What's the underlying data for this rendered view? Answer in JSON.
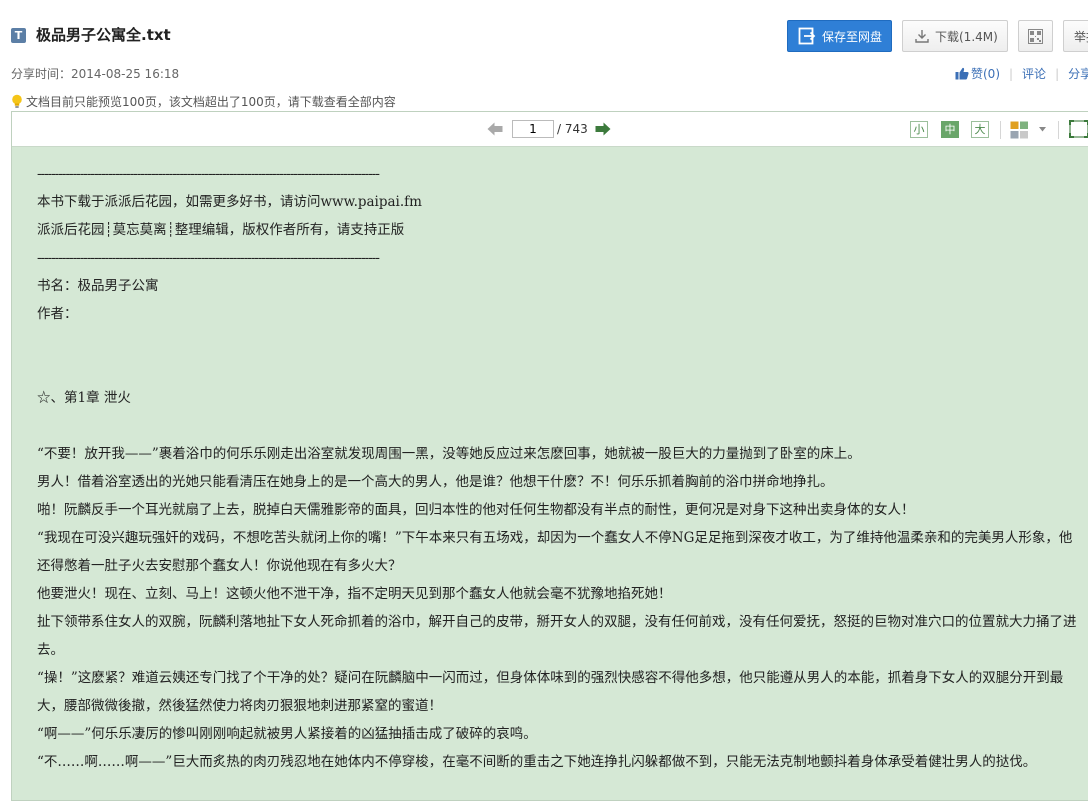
{
  "file": {
    "type_icon": "T",
    "title": "极品男子公寓全.txt"
  },
  "actions": {
    "save_label": "保存至网盘",
    "download_label": "下载(1.4M)",
    "report_label": "举报"
  },
  "meta": {
    "share_time": "分享时间：2014-08-25 16:18",
    "like_label": "赞(0)",
    "comment_label": "评论",
    "share_label": "分享"
  },
  "notice": "文档目前只能预览100页，该文档超出了100页，请下载查看全部内容",
  "viewer": {
    "current_page": "1",
    "total_pages": "/ 743",
    "size_small": "小",
    "size_medium": "中",
    "size_large": "大"
  },
  "colors": {
    "accent": "#2f7fd6",
    "reading_bg": "#d5e8d5",
    "link": "#3b6fb6"
  },
  "document": {
    "lines": [
      {
        "kind": "dash",
        "text": "------------------------------------------------------------------------------------------------"
      },
      {
        "kind": "text",
        "text": "本书下载于派派后花园，如需更多好书，请访问www.paipai.fm"
      },
      {
        "kind": "text",
        "text": "派派后花园┊莫忘莫离┊整理编辑，版权作者所有，请支持正版"
      },
      {
        "kind": "dash",
        "text": "------------------------------------------------------------------------------------------------"
      },
      {
        "kind": "text",
        "text": "书名：极品男子公寓"
      },
      {
        "kind": "text",
        "text": "作者："
      },
      {
        "kind": "blank",
        "text": ""
      },
      {
        "kind": "blank",
        "text": ""
      },
      {
        "kind": "text",
        "text": "☆、第1章 泄火"
      },
      {
        "kind": "blank",
        "text": ""
      },
      {
        "kind": "text",
        "text": "“不要！放开我——”裹着浴巾的何乐乐刚走出浴室就发现周围一黑，没等她反应过来怎麽回事，她就被一股巨大的力量抛到了卧室的床上。"
      },
      {
        "kind": "text",
        "text": "男人！借着浴室透出的光她只能看清压在她身上的是一个高大的男人，他是谁？他想干什麽？不！何乐乐抓着胸前的浴巾拼命地挣扎。"
      },
      {
        "kind": "text",
        "text": "啪！阮麟反手一个耳光就扇了上去，脱掉白天儒雅影帝的面具，回归本性的他对任何生物都没有半点的耐性，更何况是对身下这种出卖身体的女人！"
      },
      {
        "kind": "wrap",
        "text": "“我现在可没兴趣玩强奸的戏码，不想吃苦头就闭上你的嘴！”下午本来只有五场戏，却因为一个蠢女人不停NG足足拖到深夜才收工，为了维持他温柔亲和的完美男人形象，他还得憋着一肚子火去安慰那个蠢女人！你说他现在有多火大？"
      },
      {
        "kind": "text",
        "text": "他要泄火！现在、立刻、马上！这顿火他不泄干净，指不定明天见到那个蠢女人他就会毫不犹豫地掐死她！"
      },
      {
        "kind": "wrap",
        "text": "扯下领带系住女人的双腕，阮麟利落地扯下女人死命抓着的浴巾，解开自己的皮带，掰开女人的双腿，没有任何前戏，没有任何爱抚，怒挺的巨物对准穴口的位置就大力捅了进去。"
      },
      {
        "kind": "wrap",
        "text": "“操！”这麽紧？难道云姨还专门找了个干净的处？疑问在阮麟脑中一闪而过，但身体体味到的强烈快感容不得他多想，他只能遵从男人的本能，抓着身下女人的双腿分开到最大，腰部微微後撤，然後猛然使力将肉刃狠狠地刺进那紧窒的蜜道！"
      },
      {
        "kind": "text",
        "text": "“啊——”何乐乐凄厉的惨叫刚刚响起就被男人紧接着的凶猛抽插击成了破碎的哀鸣。"
      },
      {
        "kind": "wrap",
        "text": "“不……啊……啊——”巨大而炙热的肉刃残忍地在她体内不停穿梭，在毫不间断的重击之下她连挣扎闪躲都做不到，只能无法克制地颤抖着身体承受着健壮男人的挞伐。"
      }
    ]
  }
}
